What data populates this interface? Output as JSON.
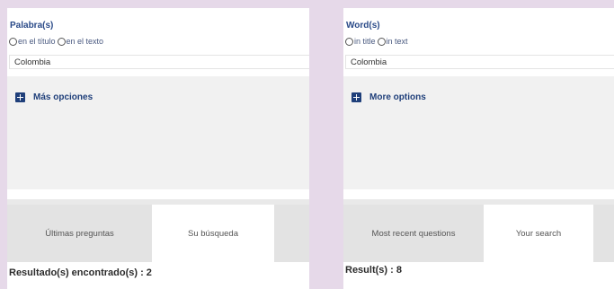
{
  "panels": [
    {
      "language": "es",
      "field_label": "Palabra(s)",
      "radio_options": [
        "en el título",
        "en el texto"
      ],
      "search_value": "Colombia",
      "more_options_label": "Más opciones",
      "tabs": [
        "Últimas preguntas",
        "Su búsqueda"
      ],
      "active_tab": 1,
      "results_text": "Resultado(s) encontrado(s) : 2"
    },
    {
      "language": "en",
      "field_label": "Word(s)",
      "radio_options": [
        "in title",
        "in text"
      ],
      "search_value": "Colombia",
      "more_options_label": "More options",
      "tabs": [
        "Most recent questions",
        "Your search"
      ],
      "active_tab": 1,
      "results_text": "Result(s) : 8"
    }
  ],
  "colors": {
    "page_background": "#e6d9e9",
    "label_blue": "#2a4a88",
    "accent_navy": "#1f3f7a",
    "tab_bar_gray": "#e3e3e3",
    "light_gray": "#f1f1f1"
  },
  "icons": {
    "more_options": "plus-square-icon",
    "radio": "radio-circle-icon"
  }
}
